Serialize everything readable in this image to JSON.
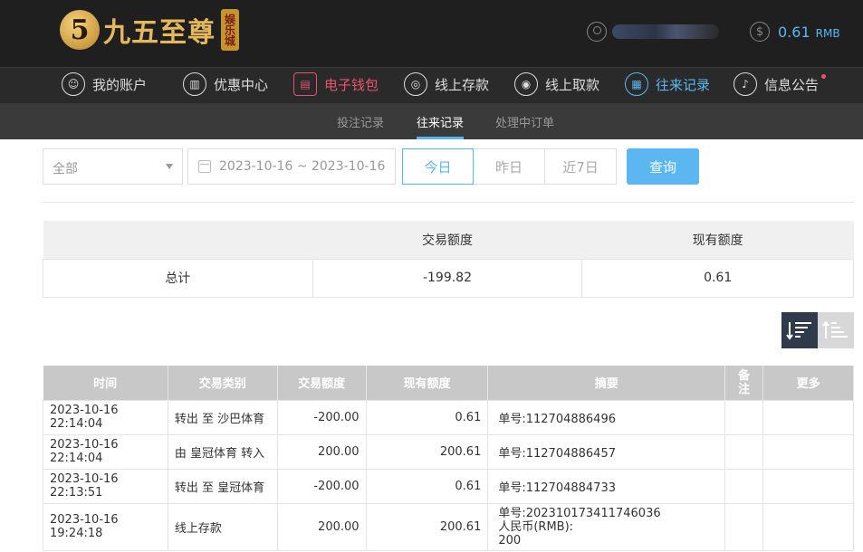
{
  "header": {
    "logo_text": "九五至尊",
    "logo_badge": "娱乐城",
    "balance_value": "0.61",
    "balance_unit": "RMB"
  },
  "nav": [
    {
      "label": "我的账户",
      "icon": "user-icon"
    },
    {
      "label": "优惠中心",
      "icon": "gift-icon"
    },
    {
      "label": "电子钱包",
      "icon": "wallet-icon"
    },
    {
      "label": "线上存款",
      "icon": "deposit-icon"
    },
    {
      "label": "线上取款",
      "icon": "withdraw-icon"
    },
    {
      "label": "往来记录",
      "icon": "records-icon"
    },
    {
      "label": "信息公告",
      "icon": "bell-icon"
    }
  ],
  "subnav": [
    {
      "label": "投注记录"
    },
    {
      "label": "往来记录"
    },
    {
      "label": "处理中订单"
    }
  ],
  "filters": {
    "type_select": "全部",
    "date_range": "2023-10-16 ~ 2023-10-16",
    "quick": [
      "今日",
      "昨日",
      "近7日"
    ],
    "query_label": "查询"
  },
  "summary": {
    "headers": [
      "",
      "交易额度",
      "现有额度"
    ],
    "row": [
      "总计",
      "-199.82",
      "0.61"
    ]
  },
  "records": {
    "headers": [
      "时间",
      "交易类别",
      "交易额度",
      "现有额度",
      "摘要",
      "备注",
      "更多"
    ],
    "rows": [
      [
        "2023-10-16 22:14:04",
        "转出 至 沙巴体育",
        "-200.00",
        "0.61",
        "单号:112704886496",
        "",
        ""
      ],
      [
        "2023-10-16 22:14:04",
        "由 皇冠体育 转入",
        "200.00",
        "200.61",
        "单号:112704886457",
        "",
        ""
      ],
      [
        "2023-10-16 22:13:51",
        "转出 至 皇冠体育",
        "-200.00",
        "0.61",
        "单号:112704884733",
        "",
        ""
      ],
      [
        "2023-10-16 19:24:18",
        "线上存款",
        "200.00",
        "200.61",
        "单号:202310173411746036",
        "",
        ""
      ]
    ],
    "row4_extra_line1": "人民币(RMB):",
    "row4_extra_line2": "200"
  },
  "colors": {
    "accent": "#5ab7f2",
    "wallet": "#e9546b",
    "logo_gold": "#e6b85c"
  }
}
